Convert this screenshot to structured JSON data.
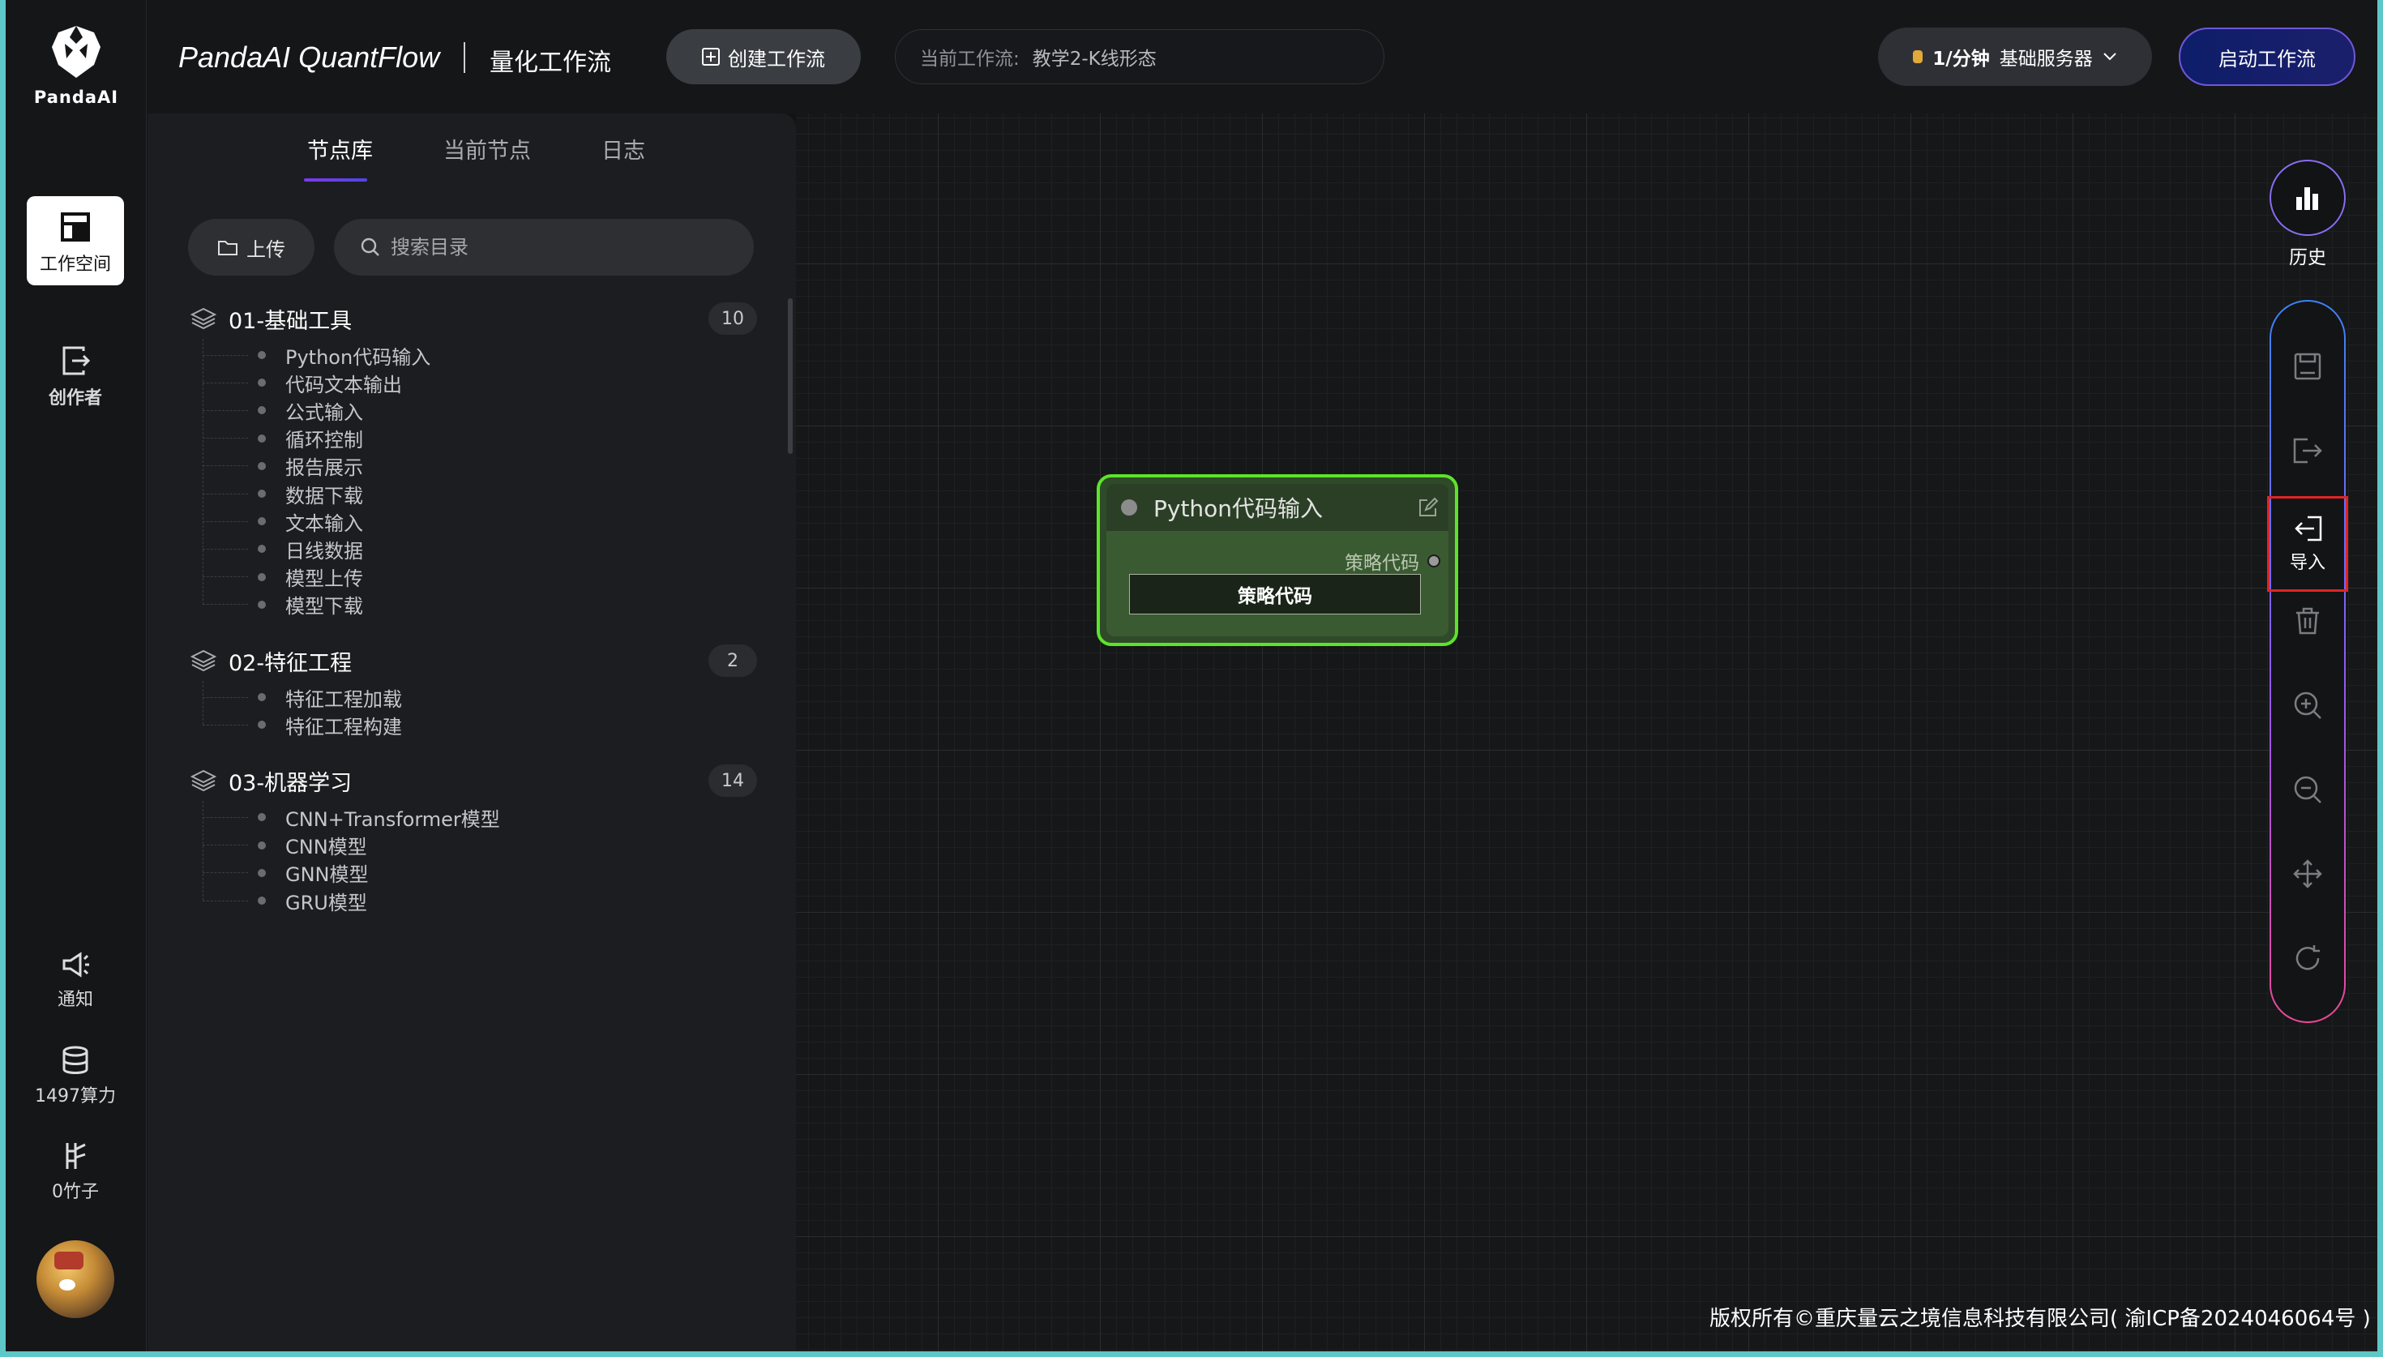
{
  "brand": {
    "name": "PandaAI"
  },
  "rail": {
    "workspace": "工作空间",
    "creator": "创作者",
    "notify": "通知",
    "compute": "1497算力",
    "bamboo": "0竹子"
  },
  "header": {
    "title": "PandaAI QuantFlow",
    "subtitle": "量化工作流",
    "create_button": "创建工作流",
    "current_label": "当前工作流:",
    "current_value": "教学2-K线形态",
    "server_rate": "1/分钟",
    "server_name": "基础服务器",
    "start_button": "启动工作流"
  },
  "panel": {
    "tabs": [
      "节点库",
      "当前节点",
      "日志"
    ],
    "upload": "上传",
    "search_placeholder": "搜索目录",
    "categories": [
      {
        "name": "01-基础工具",
        "count": "10",
        "items": [
          "Python代码输入",
          "代码文本输出",
          "公式输入",
          "循环控制",
          "报告展示",
          "数据下载",
          "文本输入",
          "日线数据",
          "模型上传",
          "模型下载"
        ]
      },
      {
        "name": "02-特征工程",
        "count": "2",
        "items": [
          "特征工程加载",
          "特征工程构建"
        ]
      },
      {
        "name": "03-机器学习",
        "count": "14",
        "items": [
          "CNN+Transformer模型",
          "CNN模型",
          "GNN模型",
          "GRU模型"
        ]
      }
    ]
  },
  "node": {
    "title": "Python代码输入",
    "output_label": "策略代码",
    "button": "策略代码",
    "border_color": "#5be42a"
  },
  "tools": {
    "history": "历史",
    "import": "导入",
    "icons": [
      "save-icon",
      "export-icon",
      "import-icon",
      "trash-icon",
      "zoom-in-icon",
      "zoom-out-icon",
      "fit-view-icon",
      "refresh-icon"
    ]
  },
  "footer": {
    "copyright": "版权所有©重庆量云之境信息科技有限公司( 渝ICP备2024046064号 )"
  }
}
